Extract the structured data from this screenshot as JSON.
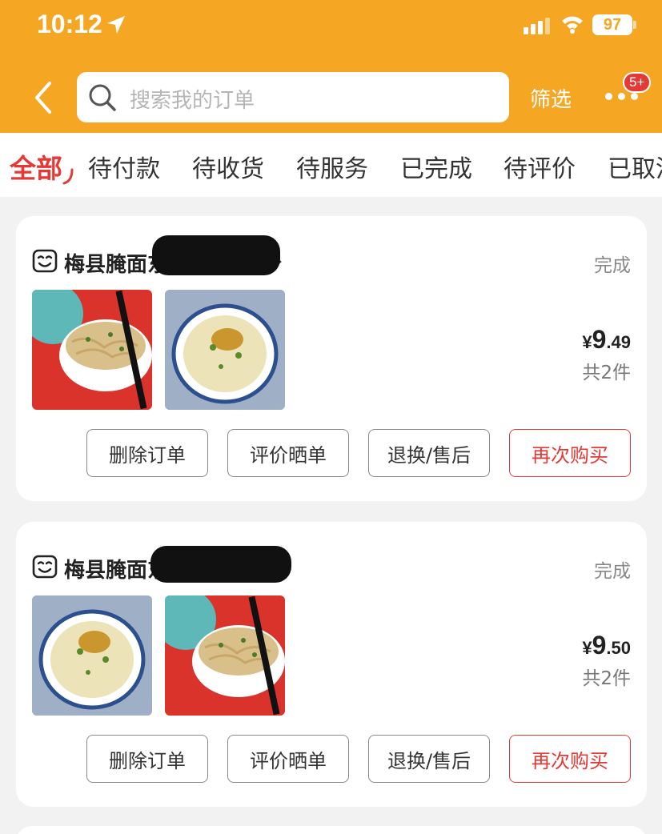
{
  "status_bar": {
    "time": "10:12",
    "battery": "97"
  },
  "header": {
    "search_placeholder": "搜索我的订单",
    "filter_label": "筛选",
    "badge": "5+"
  },
  "tabs": [
    {
      "label": "全部",
      "active": true
    },
    {
      "label": "待付款"
    },
    {
      "label": "待收货"
    },
    {
      "label": "待服务"
    },
    {
      "label": "已完成"
    },
    {
      "label": "待评价"
    },
    {
      "label": "已取消"
    }
  ],
  "orders": [
    {
      "shop_name": "梅县腌面东莞东坑店",
      "status": "完成",
      "price_symbol": "¥",
      "price_int": "9",
      "price_dec": ".49",
      "count": "共2件",
      "buttons": [
        "删除订单",
        "评价晒单",
        "退换/售后",
        "再次购买"
      ]
    },
    {
      "shop_name": "梅县腌面东莞东坑店",
      "status": "完成",
      "price_symbol": "¥",
      "price_int": "9",
      "price_dec": ".50",
      "count": "共2件",
      "buttons": [
        "删除订单",
        "评价晒单",
        "退换/售后",
        "再次购买"
      ]
    }
  ],
  "colors": {
    "header_bg": "#f5a623",
    "accent_red": "#e53935",
    "page_bg": "#f2f2f2"
  },
  "icons": [
    "location-arrow-icon",
    "signal-icon",
    "wifi-icon",
    "back-chevron-icon",
    "search-icon",
    "more-dots-icon",
    "shop-bag-icon",
    "chevron-right-icon"
  ]
}
